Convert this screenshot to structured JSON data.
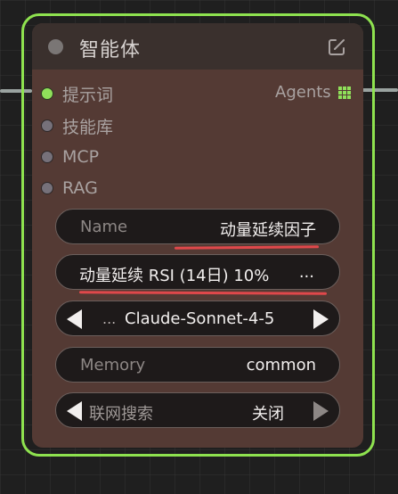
{
  "node": {
    "title": "智能体",
    "inputs": [
      {
        "label": "提示词",
        "connected": true
      },
      {
        "label": "技能库",
        "connected": false
      },
      {
        "label": "MCP",
        "connected": false
      },
      {
        "label": "RAG",
        "connected": false
      }
    ],
    "output": {
      "label": "Agents"
    }
  },
  "fields": {
    "name": {
      "label": "Name",
      "value": "动量延续因子"
    },
    "prompt": {
      "value": "动量延续 RSI (14日) 10%",
      "ellipsis": "..."
    },
    "model": {
      "prefix": "...",
      "value": "Claude-Sonnet-4-5"
    },
    "memory": {
      "label": "Memory",
      "value": "common"
    },
    "web_search": {
      "label": "联网搜索",
      "value": "关闭"
    }
  },
  "colors": {
    "outline": "#8ee24f",
    "node_body": "#543a34",
    "node_header": "#3a302d",
    "connected_port": "#8fe05a",
    "annotation": "#e0484b"
  }
}
